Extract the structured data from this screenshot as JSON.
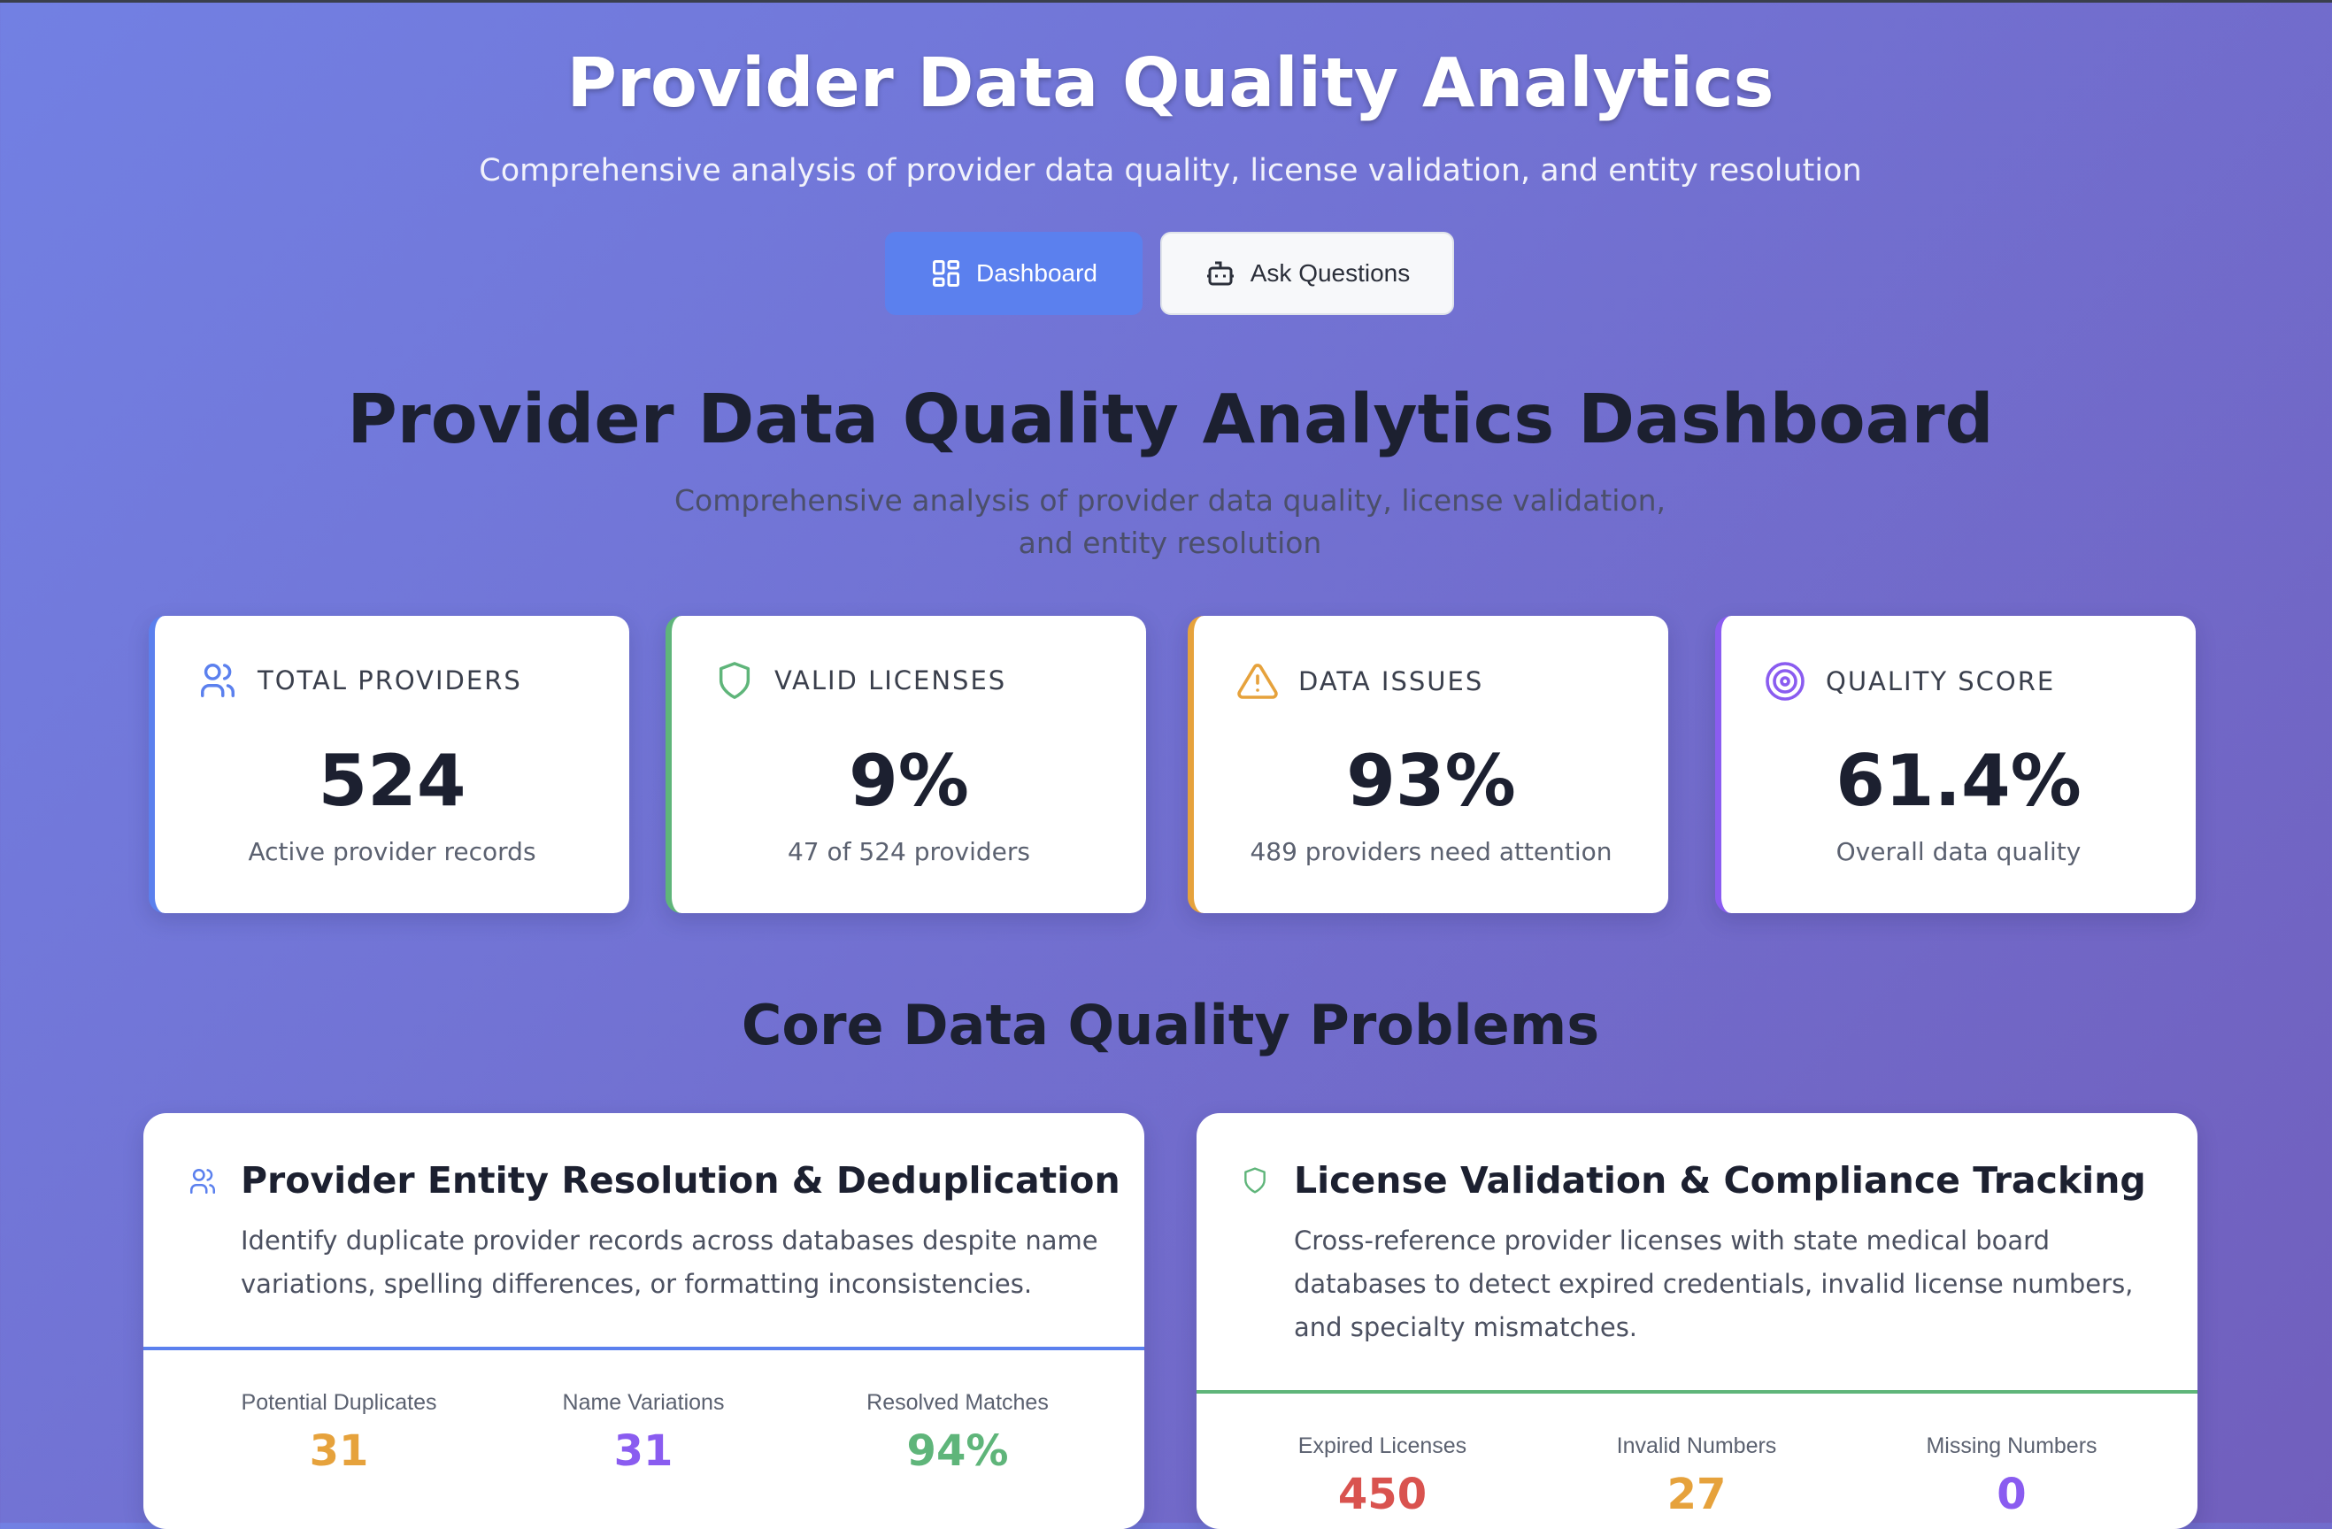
{
  "header": {
    "title": "Provider Data Quality Analytics",
    "subtitle": "Comprehensive analysis of provider data quality, license validation, and entity resolution"
  },
  "nav": {
    "dashboard_label": "Dashboard",
    "ask_label": "Ask Questions",
    "active": "Dashboard"
  },
  "main": {
    "heading": "Provider Data Quality Analytics Dashboard",
    "description": "Comprehensive analysis of provider data quality, license validation, and entity resolution"
  },
  "stats": [
    {
      "label": "TOTAL PROVIDERS",
      "value": "524",
      "sub": "Active provider records",
      "icon": "users-icon",
      "color": "#5b80ee"
    },
    {
      "label": "VALID LICENSES",
      "value": "9%",
      "sub": "47 of 524 providers",
      "icon": "shield-icon",
      "color": "#5fb57a"
    },
    {
      "label": "DATA ISSUES",
      "value": "93%",
      "sub": "489 providers need attention",
      "icon": "warning-icon",
      "color": "#e6a23c"
    },
    {
      "label": "QUALITY SCORE",
      "value": "61.4%",
      "sub": "Overall data quality",
      "icon": "target-icon",
      "color": "#8a5cf0"
    }
  ],
  "section": {
    "title": "Core Data Quality Problems"
  },
  "problems": [
    {
      "title": "Provider Entity Resolution & Deduplication",
      "description": "Identify duplicate provider records across databases despite name variations, spelling differences, or formatting inconsistencies.",
      "icon": "users-icon",
      "accent": "#5b80ee",
      "metrics": [
        {
          "label": "Potential Duplicates",
          "value": "31",
          "color": "#e6a23c"
        },
        {
          "label": "Name Variations",
          "value": "31",
          "color": "#8a5cf0"
        },
        {
          "label": "Resolved Matches",
          "value": "94%",
          "color": "#5fb57a"
        }
      ]
    },
    {
      "title": "License Validation & Compliance Tracking",
      "description": "Cross-reference provider licenses with state medical board databases to detect expired credentials, invalid license numbers, and specialty mismatches.",
      "icon": "shield-icon",
      "accent": "#5fb57a",
      "metrics": [
        {
          "label": "Expired Licenses",
          "value": "450",
          "color": "#d9534f"
        },
        {
          "label": "Invalid Numbers",
          "value": "27",
          "color": "#e6a23c"
        },
        {
          "label": "Missing Numbers",
          "value": "0",
          "color": "#8a5cf0"
        }
      ]
    }
  ]
}
